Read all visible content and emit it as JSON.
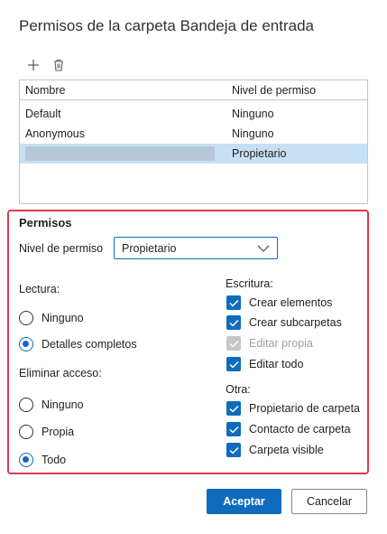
{
  "dialog": {
    "title": "Permisos de la carpeta Bandeja de entrada"
  },
  "toolbar": {
    "add_icon": "plus-icon",
    "delete_icon": "trash-icon"
  },
  "table": {
    "headers": [
      "Nombre",
      "Nivel de permiso"
    ],
    "rows": [
      {
        "name": "Default",
        "level": "Ninguno"
      },
      {
        "name": "Anonymous",
        "level": "Ninguno"
      },
      {
        "name": "",
        "level": "Propietario"
      }
    ]
  },
  "permissions": {
    "heading": "Permisos",
    "level_label": "Nivel de permiso",
    "level_value": "Propietario",
    "read": {
      "label": "Lectura:",
      "options": [
        "Ninguno",
        "Detalles completos"
      ],
      "selected": "Detalles completos"
    },
    "delete": {
      "label": "Eliminar acceso:",
      "options": [
        "Ninguno",
        "Propia",
        "Todo"
      ],
      "selected": "Todo"
    },
    "write": {
      "label": "Escritura:",
      "items": [
        {
          "label": "Crear elementos",
          "checked": true,
          "disabled": false
        },
        {
          "label": "Crear subcarpetas",
          "checked": true,
          "disabled": false
        },
        {
          "label": "Editar propia",
          "checked": true,
          "disabled": true
        },
        {
          "label": "Editar todo",
          "checked": true,
          "disabled": false
        }
      ]
    },
    "other": {
      "label": "Otra:",
      "items": [
        {
          "label": "Propietario de carpeta",
          "checked": true
        },
        {
          "label": "Contacto de carpeta",
          "checked": true
        },
        {
          "label": "Carpeta visible",
          "checked": true
        }
      ]
    }
  },
  "buttons": {
    "accept": "Aceptar",
    "cancel": "Cancelar"
  },
  "colors": {
    "accent": "#0f6cbd",
    "highlight_border": "#e03a47",
    "selected_row": "#c7e0f4"
  }
}
